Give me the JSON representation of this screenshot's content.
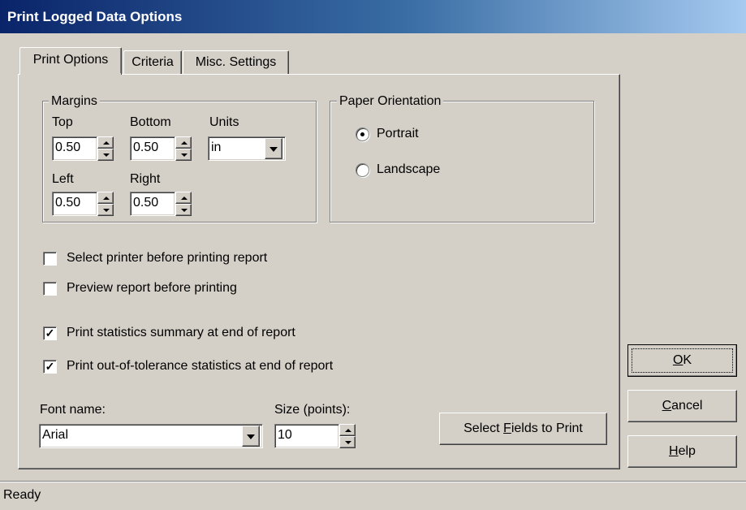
{
  "window": {
    "title": "Print Logged Data Options"
  },
  "tabs": [
    {
      "label": "Print Options",
      "active": true
    },
    {
      "label": "Criteria",
      "active": false
    },
    {
      "label": "Misc. Settings",
      "active": false
    }
  ],
  "margins": {
    "legend": "Margins",
    "top_label": "Top",
    "top_value": "0.50",
    "bottom_label": "Bottom",
    "bottom_value": "0.50",
    "units_label": "Units",
    "units_value": "in",
    "left_label": "Left",
    "left_value": "0.50",
    "right_label": "Right",
    "right_value": "0.50"
  },
  "orientation": {
    "legend": "Paper Orientation",
    "options": [
      {
        "label": "Portrait",
        "selected": true
      },
      {
        "label": "Landscape",
        "selected": false
      }
    ]
  },
  "checkboxes": [
    {
      "label": "Select printer before printing report",
      "checked": false
    },
    {
      "label": "Preview report before printing",
      "checked": false
    },
    {
      "label": "Print statistics summary at end of report",
      "checked": true
    },
    {
      "label": "Print out-of-tolerance statistics at end of report",
      "checked": true
    }
  ],
  "font": {
    "name_label": "Font name:",
    "name_value": "Arial",
    "size_label": "Size (points):",
    "size_value": "10"
  },
  "buttons": {
    "select_fields": {
      "pre": "Select ",
      "key": "F",
      "post": "ields to Print"
    },
    "ok": {
      "pre": "",
      "key": "O",
      "post": "K"
    },
    "cancel": {
      "pre": "",
      "key": "C",
      "post": "ancel"
    },
    "help": {
      "pre": "",
      "key": "H",
      "post": "elp"
    }
  },
  "status": {
    "text": "Ready"
  },
  "colors": {
    "titlebar_start": "#0a246a",
    "titlebar_end": "#a6caf0",
    "face": "#d4d0c8"
  }
}
